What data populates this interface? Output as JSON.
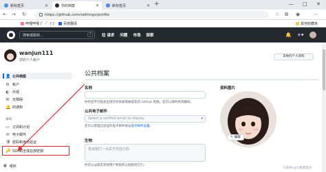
{
  "browser": {
    "tabs": [
      {
        "label": "新标签页",
        "active": false,
        "color": "#4a90e2"
      },
      {
        "label": "你的档案",
        "active": true,
        "color": "#24292f"
      },
      {
        "label": "新标签页",
        "active": false,
        "color": "#4a90e2"
      }
    ],
    "new_tab": "+",
    "url": "https://github.com/settings/profile",
    "bookmarks": [
      {
        "label": "哔哩哔哩 (゜-゜)つ",
        "color": "#fb7299"
      },
      {
        "label": "百度翻译",
        "color": "#2a64e4"
      }
    ],
    "other_bookmarks": "其他收藏夹",
    "window_controls": [
      "—",
      "□",
      "✕"
    ]
  },
  "header": {
    "search_placeholder": "搜索或跳转...",
    "search_key": "/",
    "nav": [
      "拉 请求",
      "问题",
      "市场",
      "探索"
    ],
    "icons": [
      "bell-icon",
      "plus-icon",
      "avatar"
    ]
  },
  "profile": {
    "username": "wanjun111",
    "account_type": "您的个人帐户",
    "goto_button": "去你的个人资料"
  },
  "sidebar": {
    "items": [
      {
        "label": "公共档案",
        "icon": "👤",
        "active": true
      },
      {
        "label": "帐户",
        "icon": "⚙"
      },
      {
        "label": "外观",
        "icon": "◐"
      },
      {
        "label": "无障碍",
        "icon": "⌘"
      },
      {
        "label": "的通知",
        "icon": "🔔"
      }
    ],
    "section_access": "访问",
    "access_items": [
      {
        "label": "订阅和计划",
        "icon": "▭"
      },
      {
        "label": "电子邮件",
        "icon": "✉"
      },
      {
        "label": "密码和身份验证",
        "icon": "🛡"
      }
    ],
    "highlighted_item": {
      "label": "SSH和全球总部密钥",
      "icon": "🔑"
    },
    "bottom_item": {
      "label": "组织",
      "icon": "▦"
    }
  },
  "main": {
    "title": "公共档案",
    "name_label": "名称",
    "name_help": "你的名字可能会出现在你贡献或被提及的 GitHub 周围。您可以随时将其删除。",
    "email_label": "公共电子邮件",
    "email_placeholder": "Select a verified email to display",
    "email_help_1": "您可以管理已验证的电子邮件地址",
    "email_help_link": "电子邮件设置",
    "email_help_2": "。",
    "bio_label": "生物",
    "bio_placeholder": "告诉我们一点关于你自己的",
    "bio_help": "你可以@提及其他用户和组织以链接到它们。",
    "picture_label": "资料图片",
    "edit_button": "编辑"
  },
  "watermark": "CSDN @小新新努力"
}
